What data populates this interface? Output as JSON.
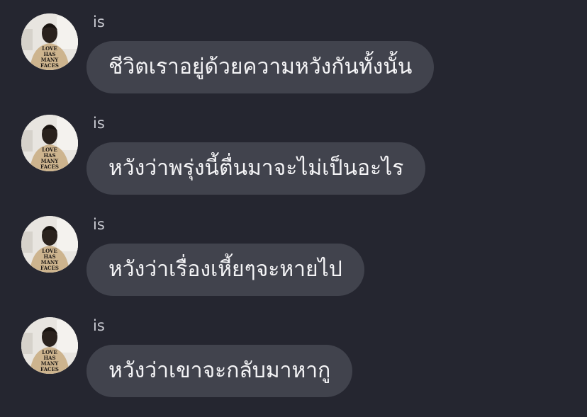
{
  "colors": {
    "background": "#252630",
    "bubble": "#41434d",
    "bubble_text": "#f4f4f6",
    "sender_text": "#c9cad1"
  },
  "avatar": {
    "icon": "profile-photo",
    "shirt_text": [
      "LOVE",
      "HAS",
      "MANY",
      "FACES"
    ]
  },
  "messages": [
    {
      "sender": "is",
      "text": "ชีวิตเราอยู่ด้วยความหวังกันทั้งนั้น"
    },
    {
      "sender": "is",
      "text": "หวังว่าพรุ่งนี้ตื่นมาจะไม่เป็นอะไร"
    },
    {
      "sender": "is",
      "text": "หวังว่าเรื่องเหี้ยๆจะหายไป"
    },
    {
      "sender": "is",
      "text": "หวังว่าเขาจะกลับมาหากู"
    }
  ]
}
